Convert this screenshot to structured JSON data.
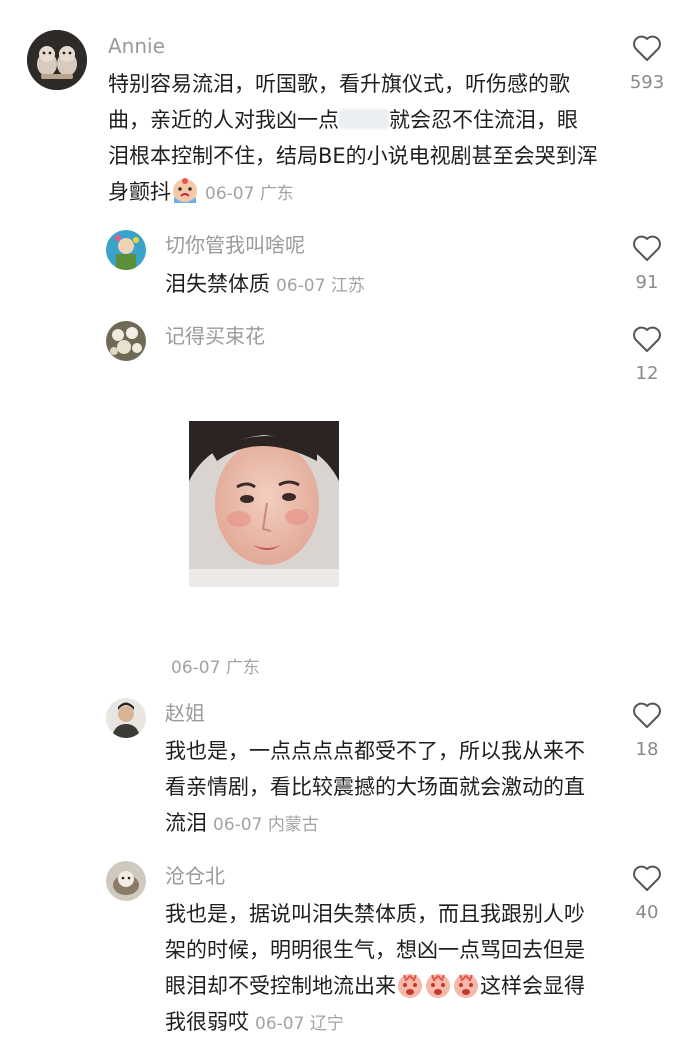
{
  "comments": [
    {
      "username": "Annie",
      "text_before_blur": "特别容易流泪，听国歌，看升旗仪式，听伤感的歌曲，亲近的人对我凶一点",
      "text_after_blur": "就会忍不住流泪，眼泪根本控制不住，结局BE的小说电视剧甚至会哭到浑身颤抖",
      "emoji": "crying-face-emoji",
      "date": "06-07",
      "location": "广东",
      "likes": "593"
    },
    {
      "username": "切你管我叫啥呢",
      "text": "泪失禁体质",
      "date": "06-07",
      "location": "江苏",
      "likes": "91"
    },
    {
      "username": "记得买束花",
      "image": "crying-selfie-photo",
      "date": "06-07",
      "location": "广东",
      "likes": "12"
    },
    {
      "username": "赵姐",
      "text": "我也是，一点点点点都受不了，所以我从来不看亲情剧，看比较震撼的大场面就会激动的直流泪",
      "date": "06-07",
      "location": "内蒙古",
      "likes": "18"
    },
    {
      "username": "沧仓北",
      "text": "我也是，据说叫泪失禁体质，而且我跟别人吵架的时候，明明很生气，想凶一点骂回去但是眼泪却不受控制地流出来",
      "text_end": "这样会显得我很弱哎",
      "emoji": "angry-crying-emoji",
      "date": "06-07",
      "location": "辽宁",
      "likes": "40"
    }
  ],
  "colors": {
    "username": "#9a9a9a",
    "text": "#1f1f1f",
    "meta": "#a3a3a3",
    "count": "#8a8a8a"
  }
}
